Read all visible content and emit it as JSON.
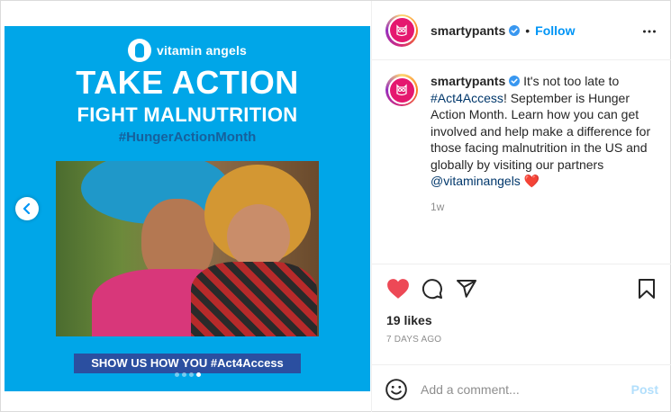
{
  "media": {
    "logo_text": "vitamin angels",
    "headline_1": "TAKE ACTION",
    "headline_2": "FIGHT MALNUTRITION",
    "hashtag": "#HungerActionMonth",
    "cta": "SHOW US HOW YOU #Act4Access",
    "carousel_dots": 4,
    "active_dot": 4,
    "prev_icon": "chevron-left-icon",
    "brand_color": "#00a6e8"
  },
  "header": {
    "username": "smartypants",
    "separator": "•",
    "follow_label": "Follow",
    "more_icon": "more-horizontal-icon"
  },
  "caption": {
    "username": "smartypants",
    "text_1": " It's not too late to ",
    "hashtag_link": "#Act4Access",
    "text_2": "! September is Hunger Action Month. Learn how you can get involved and help make a difference for those facing malnutrition in the US and globally by visiting our partners ",
    "mention_link": "@vitaminangels",
    "emoji": "❤️",
    "age": "1w"
  },
  "actions": {
    "like_icon": "heart-filled-icon",
    "comment_icon": "comment-icon",
    "share_icon": "share-icon",
    "save_icon": "bookmark-icon",
    "likes": "19 likes",
    "date": "7 DAYS AGO",
    "like_color": "#ed4956"
  },
  "comment": {
    "placeholder": "Add a comment...",
    "post_label": "Post",
    "emoji_icon": "smile-icon"
  }
}
